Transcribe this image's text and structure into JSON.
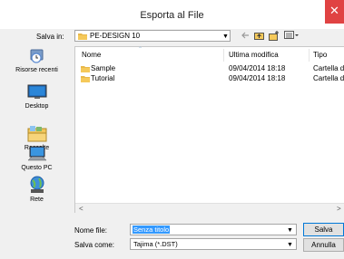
{
  "window": {
    "title": "Esporta al File",
    "close_glyph": "✕"
  },
  "save_in": {
    "label": "Salva in:",
    "value": "PE-DESIGN 10"
  },
  "toolbar": {
    "back_icon": "back-arrow-icon",
    "up_folder_icon": "up-folder-icon",
    "new_folder_icon": "new-folder-icon",
    "view_menu_icon": "view-menu-icon"
  },
  "places": [
    {
      "label": "Risorse recenti",
      "icon": "recent-places-icon"
    },
    {
      "label": "Desktop",
      "icon": "desktop-icon"
    },
    {
      "label": "Raccolte",
      "icon": "libraries-icon"
    },
    {
      "label": "Questo PC",
      "icon": "this-pc-icon"
    },
    {
      "label": "Rete",
      "icon": "network-icon"
    }
  ],
  "file_list": {
    "columns": {
      "name": "Nome",
      "modified": "Ultima modifica",
      "type": "Tipo"
    },
    "rows": [
      {
        "name": "Sample",
        "modified": "09/04/2014 18:18",
        "type": "Cartella di"
      },
      {
        "name": "Tutorial",
        "modified": "09/04/2014 18:18",
        "type": "Cartella di"
      }
    ]
  },
  "file_name": {
    "label": "Nome file:",
    "value": "Senza titolo"
  },
  "save_as": {
    "label": "Salva come:",
    "value": "Tajima (*.DST)"
  },
  "buttons": {
    "save": "Salva",
    "cancel": "Annulla"
  },
  "colors": {
    "close_bg": "#e04343",
    "selection": "#3399ff",
    "folder": "#e8b84a"
  }
}
